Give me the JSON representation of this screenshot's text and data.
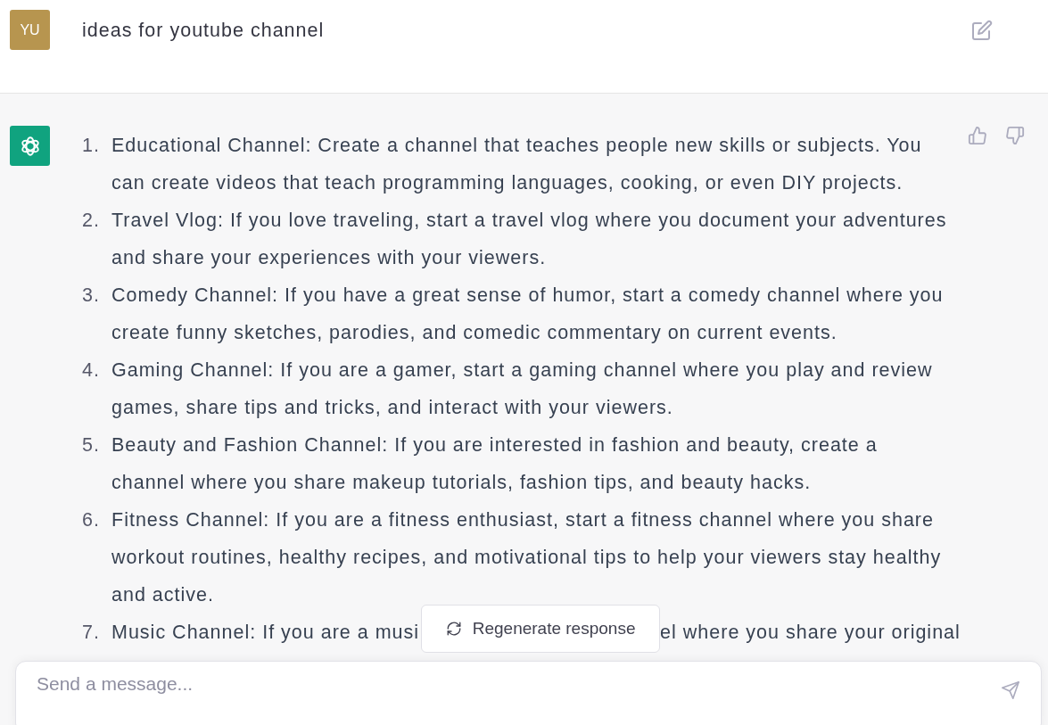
{
  "prompt": {
    "avatar_initials": "YU",
    "text": "ideas for youtube channel"
  },
  "response": {
    "items": [
      {
        "number": "1.",
        "kind": "full",
        "text": "Educational Channel: Create a channel that teaches people new skills or subjects. You can create videos that teach programming languages, cooking, or even DIY projects."
      },
      {
        "number": "2.",
        "kind": "full",
        "text": "Travel Vlog: If you love traveling, start a travel vlog where you document your adventures and share your experiences with your viewers."
      },
      {
        "number": "3.",
        "kind": "full",
        "text": "Comedy Channel: If you have a great sense of humor, start a comedy channel where you create funny sketches, parodies, and comedic commentary on current events."
      },
      {
        "number": "4.",
        "kind": "full",
        "text": "Gaming Channel: If you are a gamer, start a gaming channel where you play and review games, share tips and tricks, and interact with your viewers."
      },
      {
        "number": "5.",
        "kind": "full",
        "text": "Beauty and Fashion Channel: If you are interested in fashion and beauty, create a channel where you share makeup tutorials, fashion tips, and beauty hacks."
      },
      {
        "number": "6.",
        "kind": "full",
        "text": "Fitness Channel: If you are a fitness enthusiast, start a fitness channel where you share workout routines, healthy recipes, and motivational tips to help your viewers stay healthy and active."
      },
      {
        "number": "7.",
        "kind": "covered",
        "text_before": "Music Channel: If you are a musi",
        "text_after": "el where you share your original"
      }
    ]
  },
  "regenerate_button": {
    "label": "Regenerate response"
  },
  "composer": {
    "placeholder": "Send a message..."
  }
}
